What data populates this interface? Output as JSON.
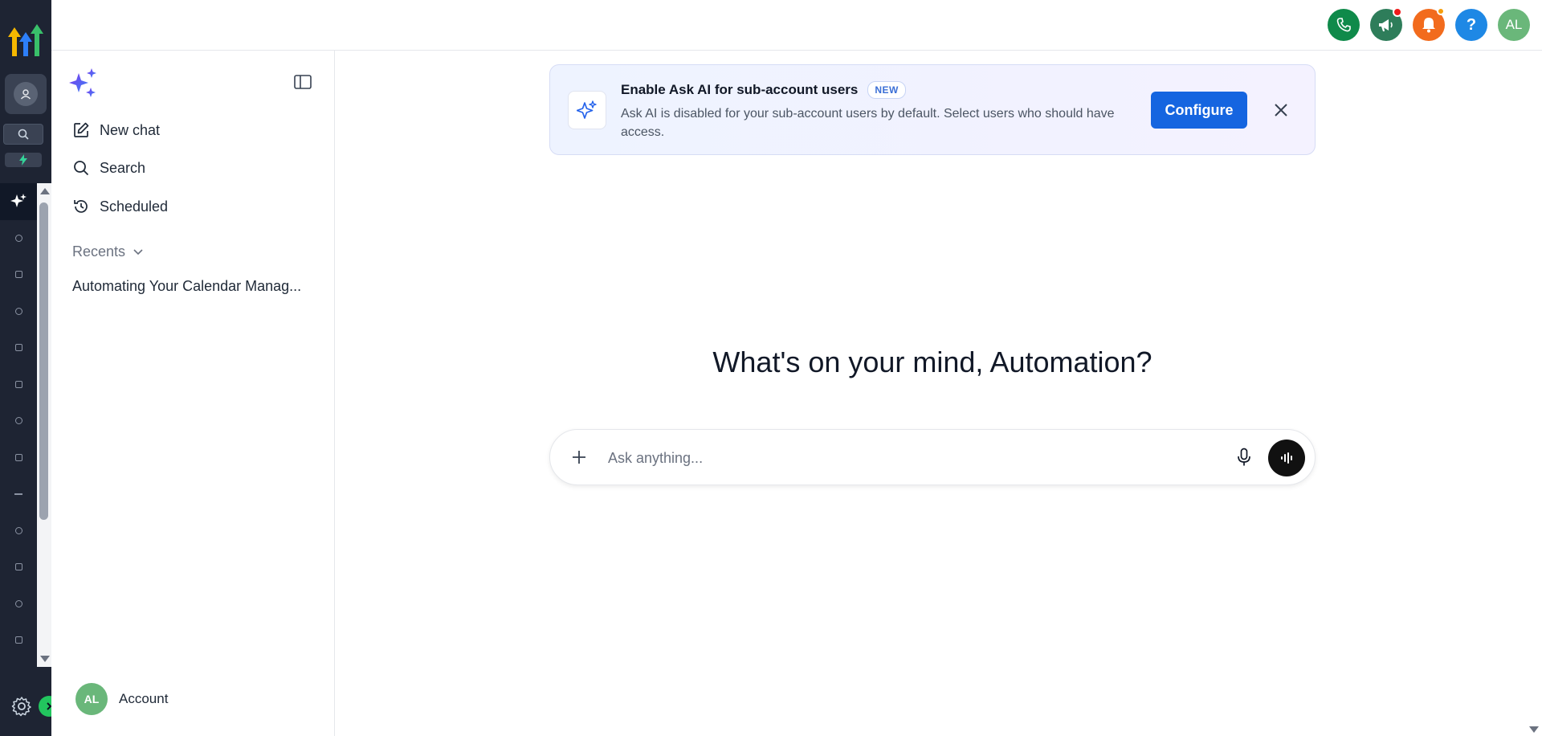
{
  "header": {
    "avatar_initials": "AL",
    "help_label": "?",
    "colors": {
      "phone": "#0f8a4a",
      "announce": "#2e7d5a",
      "notify": "#f26b1d",
      "help": "#1e88e5",
      "avatar": "#6ab77a"
    }
  },
  "rail": {
    "icons": [
      "ai-sparkle-icon",
      "target-icon",
      "grid-icon",
      "chat-icon",
      "calendar-icon",
      "contacts-icon",
      "network-icon",
      "inbox-icon",
      "minus-icon",
      "pin-icon",
      "send-icon",
      "gauge-icon",
      "box-icon",
      "more-icon"
    ]
  },
  "sidebar": {
    "items": [
      {
        "label": "New chat",
        "icon": "edit-icon"
      },
      {
        "label": "Search",
        "icon": "search-icon"
      },
      {
        "label": "Scheduled",
        "icon": "history-icon"
      }
    ],
    "recents_label": "Recents",
    "recent_items": [
      "Automating Your Calendar Manag..."
    ],
    "account_initials": "AL",
    "account_label": "Account"
  },
  "banner": {
    "title": "Enable Ask AI for sub-account users",
    "badge": "NEW",
    "description": "Ask AI is disabled for your sub-account users by default. Select users who should have access.",
    "button": "Configure"
  },
  "main": {
    "greeting": "What's on your mind, Automation?",
    "ask_placeholder": "Ask anything..."
  }
}
